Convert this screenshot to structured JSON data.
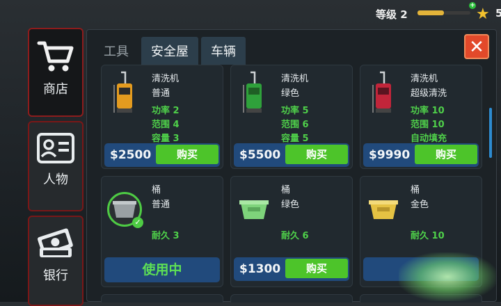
{
  "header": {
    "level_label": "等级 2",
    "star_count": "5"
  },
  "sidebar": {
    "items": [
      {
        "label": "商店",
        "icon": "cart-icon"
      },
      {
        "label": "人物",
        "icon": "id-card-icon"
      },
      {
        "label": "银行",
        "icon": "cash-icon"
      }
    ]
  },
  "tabs": [
    "工具",
    "安全屋",
    "车辆"
  ],
  "active_tab": "工具",
  "items": [
    {
      "name": "清洗机",
      "variant": "普通",
      "stats": [
        "功率 2",
        "范围 4",
        "容量 3"
      ],
      "price": "$2500",
      "action": "购买",
      "color": "#e49b1f"
    },
    {
      "name": "清洗机",
      "variant": "绿色",
      "stats": [
        "功率 5",
        "范围 6",
        "容量 5"
      ],
      "price": "$5500",
      "action": "购买",
      "color": "#2fa13b"
    },
    {
      "name": "清洗机",
      "variant": "超级清洗",
      "stats": [
        "功率 10",
        "范围 10",
        "自动填充"
      ],
      "price": "$9990",
      "action": "购买",
      "color": "#c1253a"
    },
    {
      "name": "桶",
      "variant": "普通",
      "stats": [
        "耐久 3"
      ],
      "status": "使用中",
      "color": "#9aa0a4"
    },
    {
      "name": "桶",
      "variant": "绿色",
      "stats": [
        "耐久 6"
      ],
      "price": "$1300",
      "action": "购买",
      "color": "#7ed37b"
    },
    {
      "name": "桶",
      "variant": "金色",
      "stats": [
        "耐久 10"
      ],
      "color": "#e5c243"
    }
  ],
  "colors": {
    "accent_green": "#4dc42a",
    "price_bar": "#214a7c",
    "close_red": "#e2492a",
    "sidebar_border": "#7a1717"
  }
}
